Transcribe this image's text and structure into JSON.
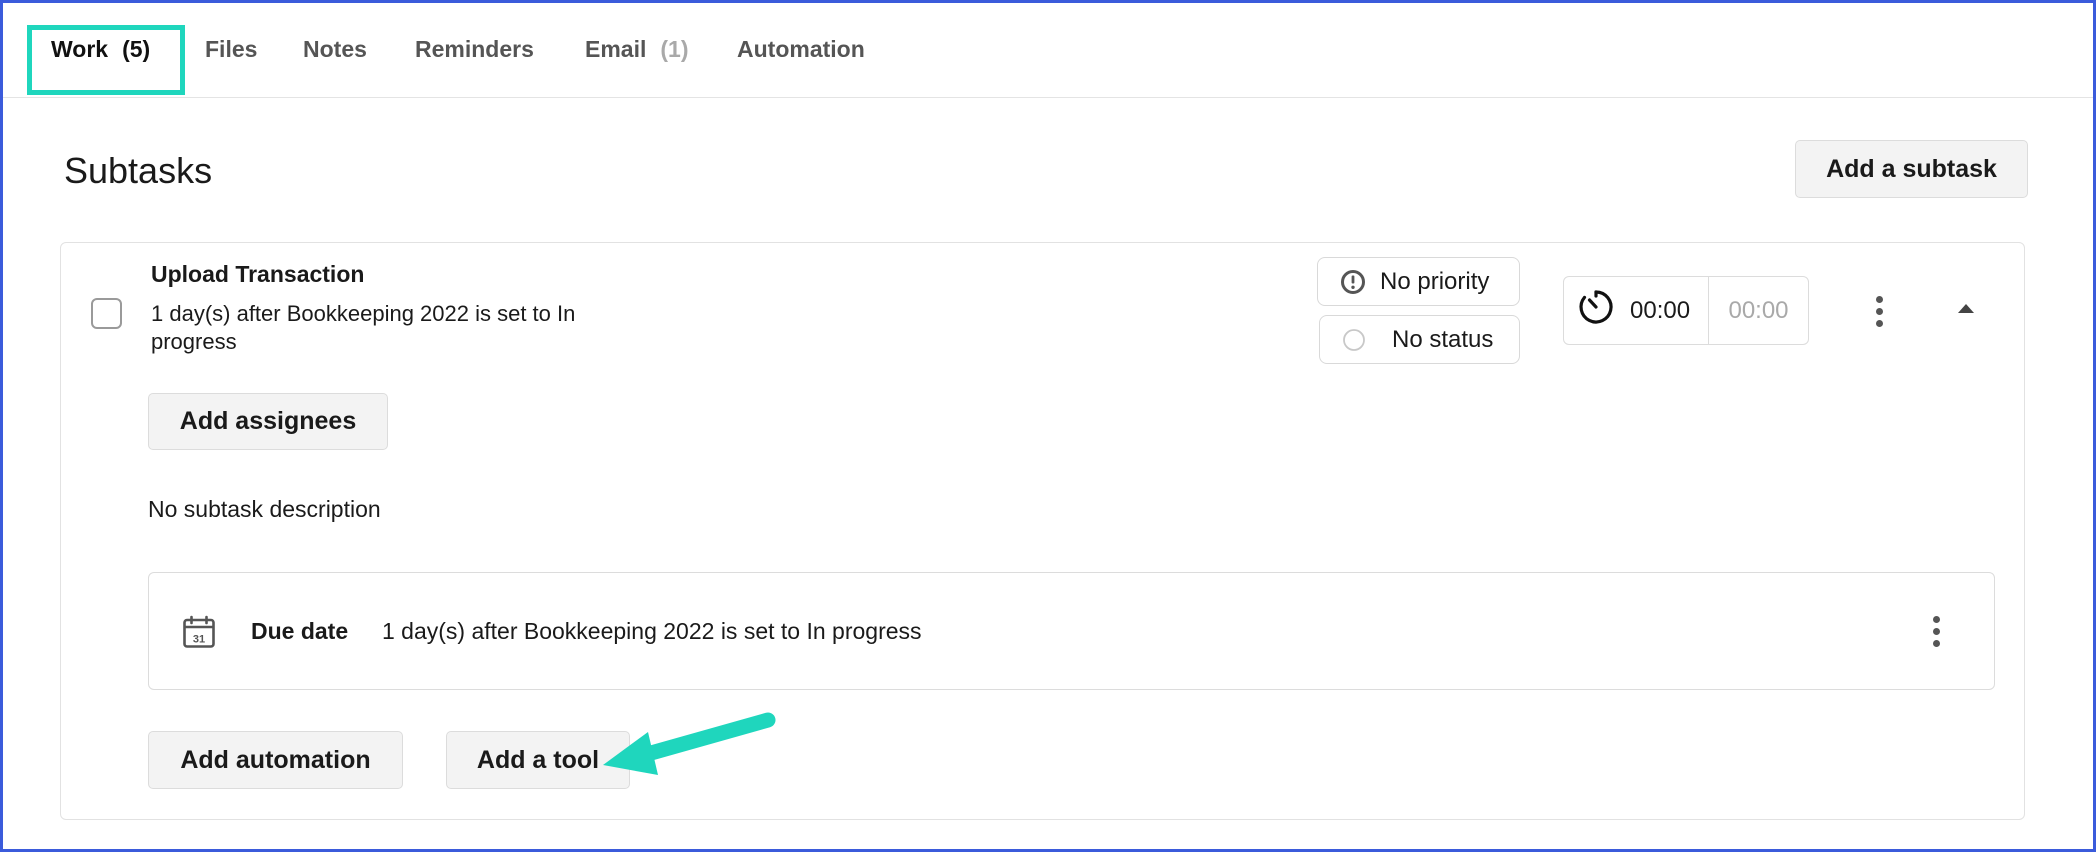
{
  "tabs": [
    {
      "label": "Work",
      "count": "(5)"
    },
    {
      "label": "Files",
      "count": ""
    },
    {
      "label": "Notes",
      "count": ""
    },
    {
      "label": "Reminders",
      "count": ""
    },
    {
      "label": "Email",
      "count": "(1)"
    },
    {
      "label": "Automation",
      "count": ""
    }
  ],
  "header": {
    "title": "Subtasks",
    "add_subtask_label": "Add a subtask"
  },
  "subtask": {
    "title": "Upload Transaction",
    "subtitle": "1 day(s) after Bookkeeping 2022 is set to In progress",
    "priority": "No priority",
    "status": "No status",
    "timer_elapsed": "00:00",
    "timer_estimate": "00:00",
    "add_assignees_label": "Add assignees",
    "description": "No subtask description",
    "due_date": {
      "label": "Due date",
      "value": "1 day(s) after Bookkeeping 2022 is set to In progress",
      "calendar_day": "31"
    },
    "add_automation_label": "Add automation",
    "add_tool_label": "Add a tool"
  },
  "icons": {
    "priority": "exclamation-circle-icon",
    "status": "empty-circle-icon",
    "timer": "stopwatch-icon",
    "calendar": "calendar-icon",
    "more": "kebab-menu-icon",
    "collapse": "caret-up-icon",
    "annotation": "arrow-icon"
  },
  "colors": {
    "highlight": "#1fd6bd",
    "frame": "#3b5bdb"
  }
}
